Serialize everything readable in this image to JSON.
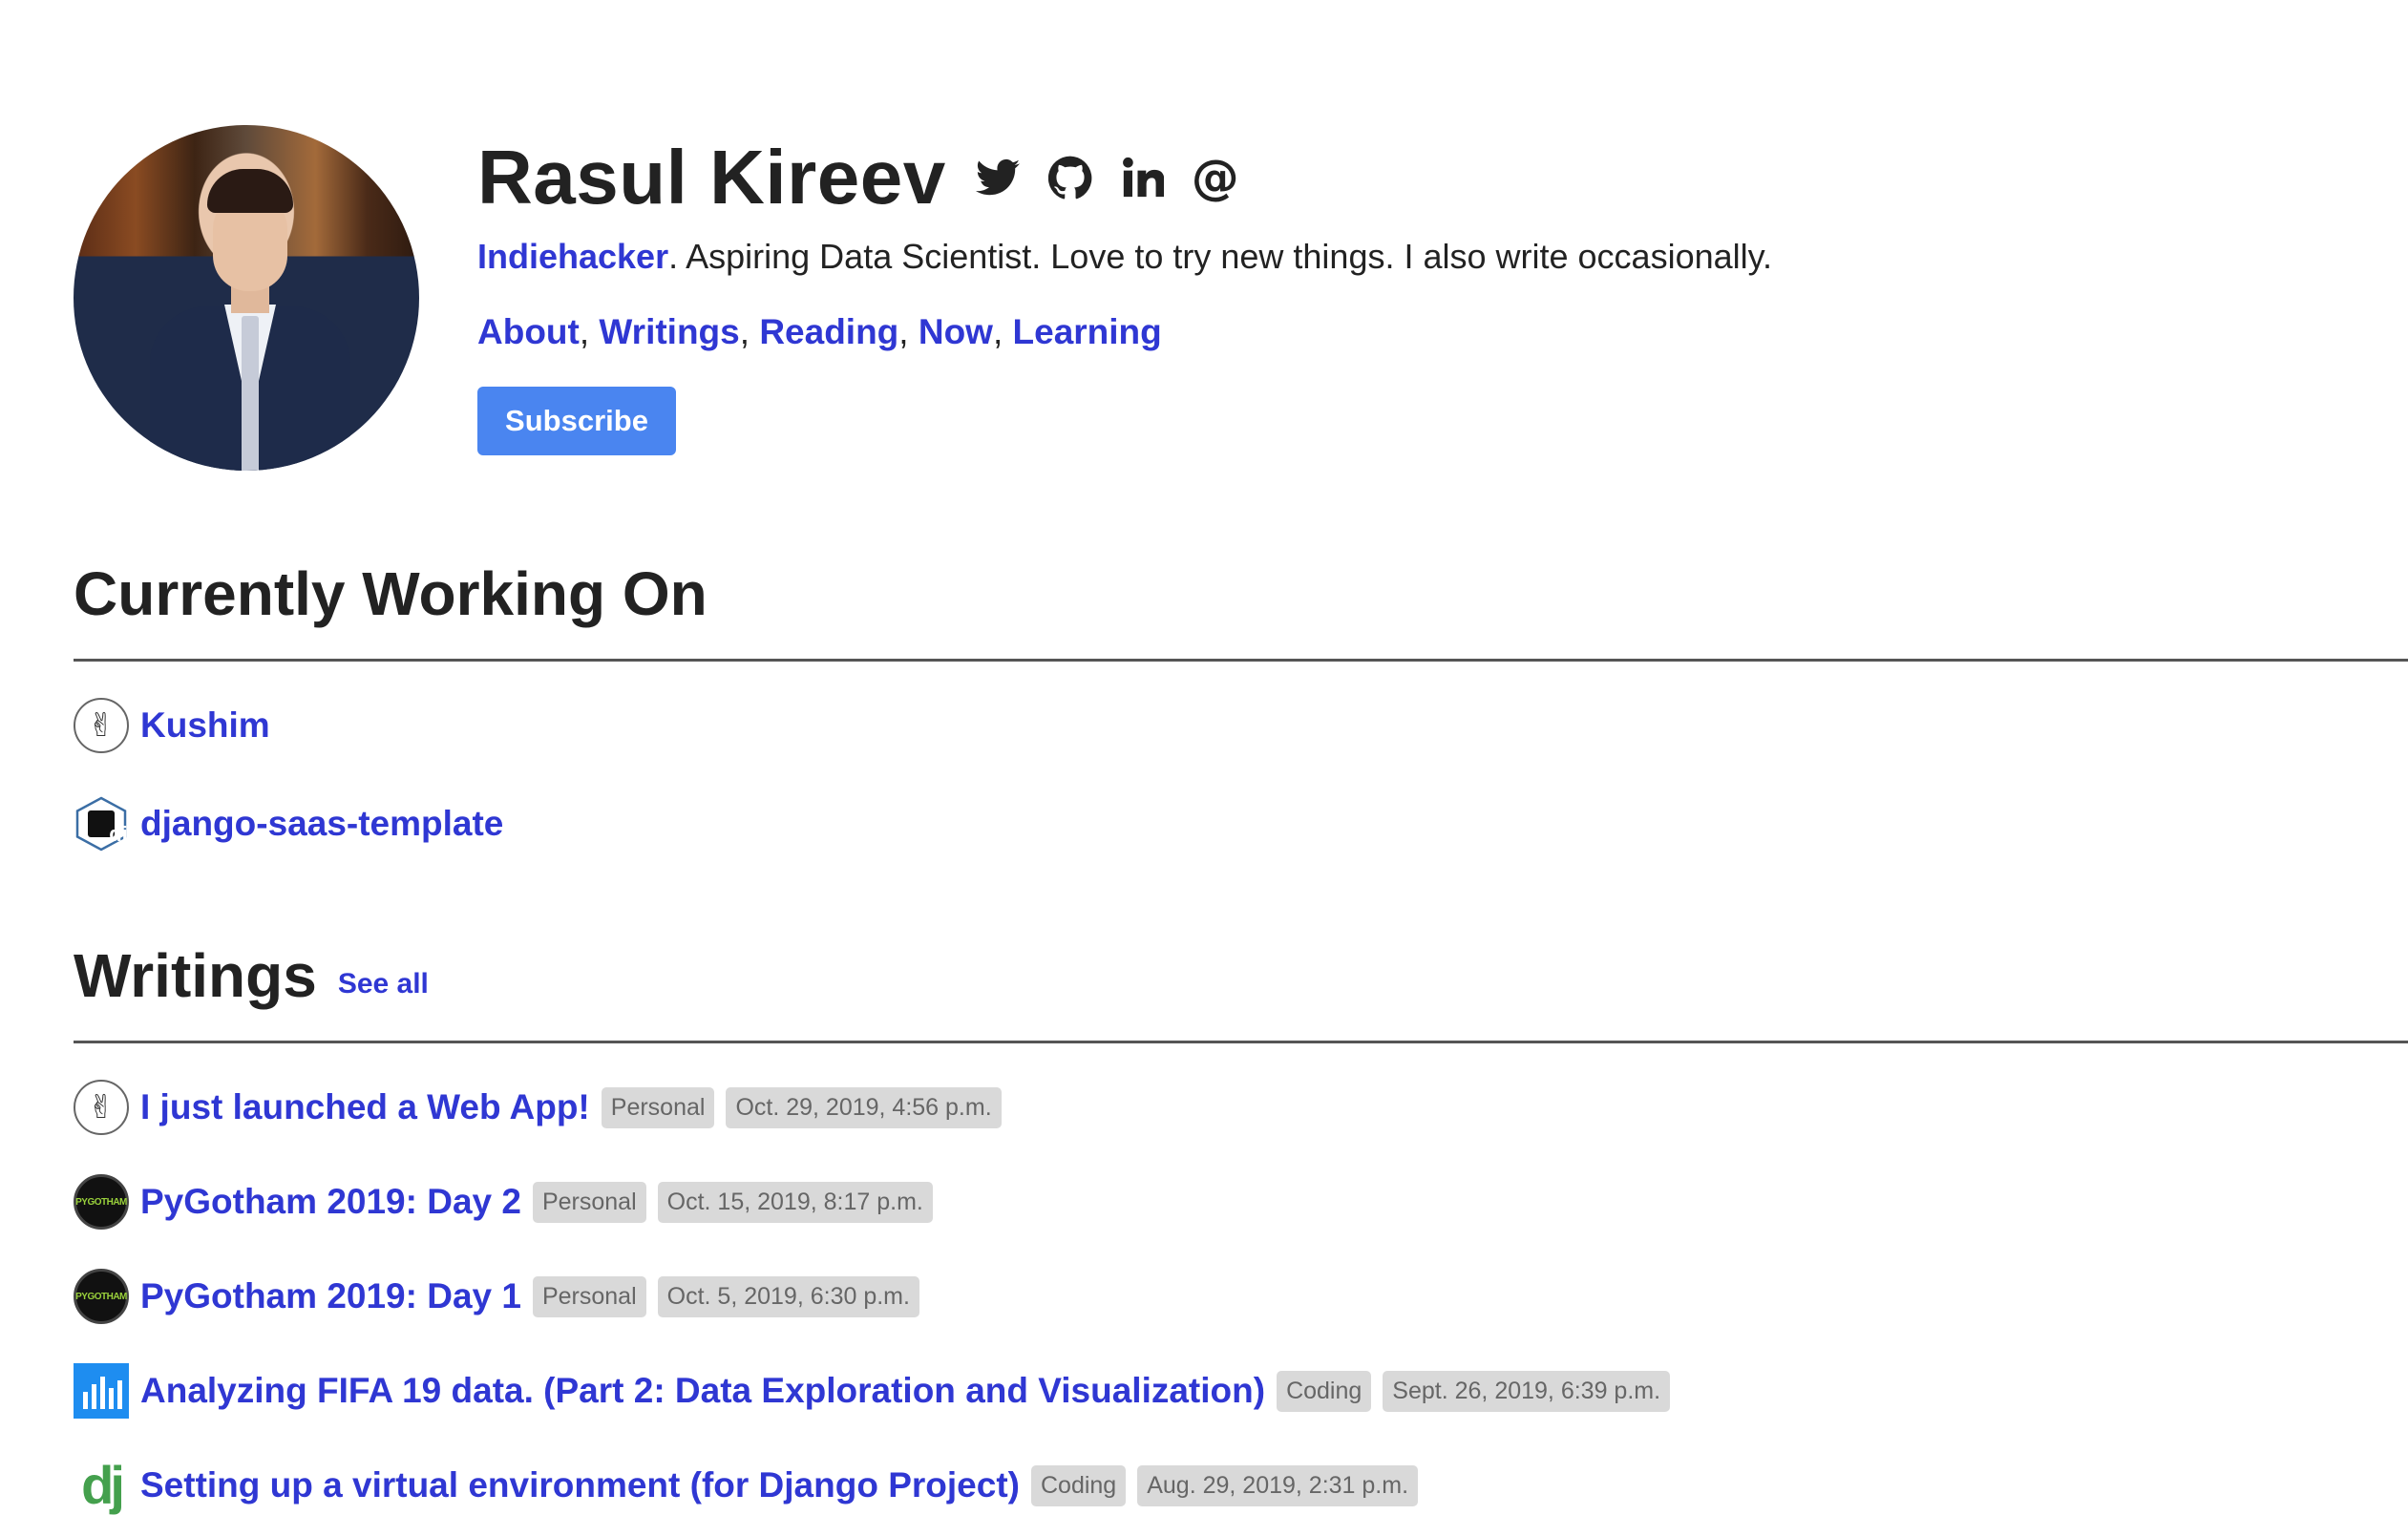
{
  "profile": {
    "name": "Rasul Kireev",
    "socials": [
      {
        "icon": "twitter-icon"
      },
      {
        "icon": "github-icon"
      },
      {
        "icon": "linkedin-icon"
      },
      {
        "icon": "email-at-icon"
      }
    ],
    "tagline_link": "Indiehacker",
    "tagline_rest": ". Aspiring Data Scientist. Love to try new things. I also write occasionally.",
    "nav": [
      "About",
      "Writings",
      "Reading",
      "Now",
      "Learning"
    ],
    "nav_sep": ",",
    "subscribe_label": "Subscribe"
  },
  "working_on": {
    "title": "Currently Working On",
    "items": [
      {
        "label": "Kushim",
        "icon": "peace-hand-icon"
      },
      {
        "label": "django-saas-template",
        "icon": "django-hex-icon",
        "icon_text": "dj"
      }
    ]
  },
  "writings": {
    "title": "Writings",
    "see_all": "See all",
    "items": [
      {
        "title": "I just launched a Web App!",
        "category": "Personal",
        "date": "Oct. 29, 2019, 4:56 p.m.",
        "icon": "peace-hand-icon"
      },
      {
        "title": "PyGotham 2019: Day 2",
        "category": "Personal",
        "date": "Oct. 15, 2019, 8:17 p.m.",
        "icon": "pygotham-icon",
        "icon_text": "PYGOTHAM"
      },
      {
        "title": "PyGotham 2019: Day 1",
        "category": "Personal",
        "date": "Oct. 5, 2019, 6:30 p.m.",
        "icon": "pygotham-icon",
        "icon_text": "PYGOTHAM"
      },
      {
        "title": "Analyzing FIFA 19 data. (Part 2: Data Exploration and Visualization)",
        "category": "Coding",
        "date": "Sept. 26, 2019, 6:39 p.m.",
        "icon": "bar-chart-icon"
      },
      {
        "title": "Setting up a virtual environment (for Django Project)",
        "category": "Coding",
        "date": "Aug. 29, 2019, 2:31 p.m.",
        "icon": "django-icon",
        "icon_text": "dj"
      }
    ]
  },
  "colors": {
    "link": "#2f37d3",
    "button": "#4a85f0",
    "badge_bg": "#d9d9d9"
  }
}
